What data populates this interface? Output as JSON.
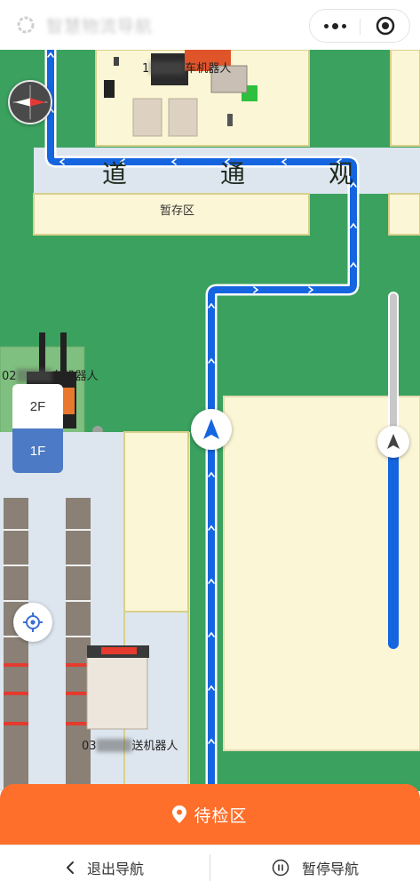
{
  "header": {
    "app_title": "智慧物流导航",
    "logo_icon": "app-logo-icon",
    "more_icon": "more-dots-icon",
    "close_icon": "miniprogram-close-icon"
  },
  "map": {
    "road_chars": [
      "道",
      "通",
      "观"
    ],
    "zones": {
      "temp_storage": "暂存区"
    },
    "robots": [
      {
        "prefix": "1",
        "suffix": "车机器人",
        "blurred": "▒▒▒▒"
      },
      {
        "prefix": "02",
        "suffix": "车机器人",
        "blurred": "▒▒▒▒"
      },
      {
        "prefix": "03",
        "suffix": "送机器人",
        "blurred": "▒▒▒▒"
      }
    ],
    "floors": {
      "upper": "2F",
      "current": "1F"
    },
    "zoom_level": 0.42,
    "colors": {
      "ground": "#3aa15f",
      "route": "#1565e0",
      "building": "#fbf6d6",
      "floor_area": "#dde6ef",
      "accent": "#ff6f2c"
    }
  },
  "destination": {
    "label": "待检区",
    "icon": "location-pin-icon"
  },
  "actions": {
    "exit_label": "退出导航",
    "pause_label": "暂停导航"
  }
}
